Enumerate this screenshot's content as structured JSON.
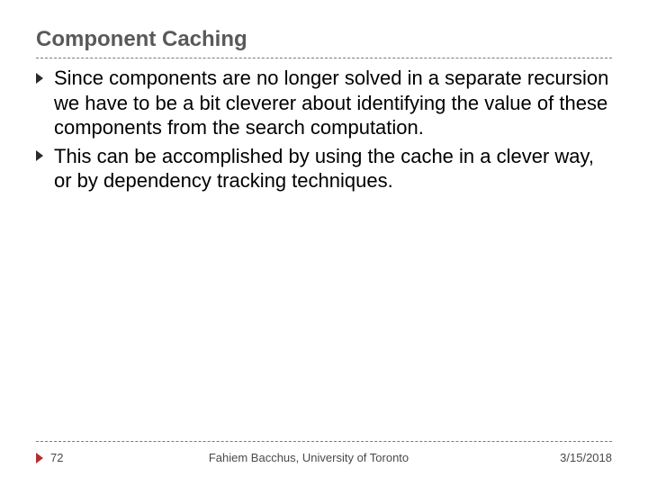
{
  "slide": {
    "title": "Component Caching",
    "bullets": [
      "Since components are no longer solved in a separate recursion we have to be a bit cleverer about identifying the value of these components from the search computation.",
      "This can be accomplished by using the cache in a clever way, or by dependency tracking techniques."
    ]
  },
  "footer": {
    "page": "72",
    "author": "Fahiem Bacchus, University of Toronto",
    "date": "3/15/2018"
  }
}
